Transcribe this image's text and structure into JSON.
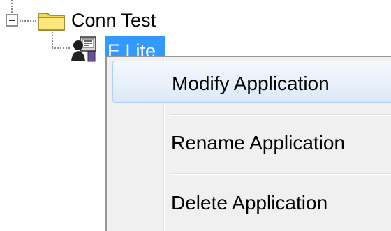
{
  "tree": {
    "root": {
      "label": "Conn Test",
      "expander": "collapse-minus-icon",
      "icon": "folder-icon"
    },
    "child": {
      "label": "E Lite",
      "icon": "application-user-icon",
      "selected": true
    }
  },
  "context_menu": {
    "items": [
      {
        "label": "Modify Application",
        "state": "hover"
      },
      {
        "label": "Rename Application",
        "state": "normal"
      },
      {
        "label": "Delete Application",
        "state": "normal"
      }
    ]
  },
  "colors": {
    "selection": "#3399ff",
    "menu_background": "#f0f0f0",
    "menu_hover_border": "#aecff7",
    "folder": "#f5d95a"
  }
}
